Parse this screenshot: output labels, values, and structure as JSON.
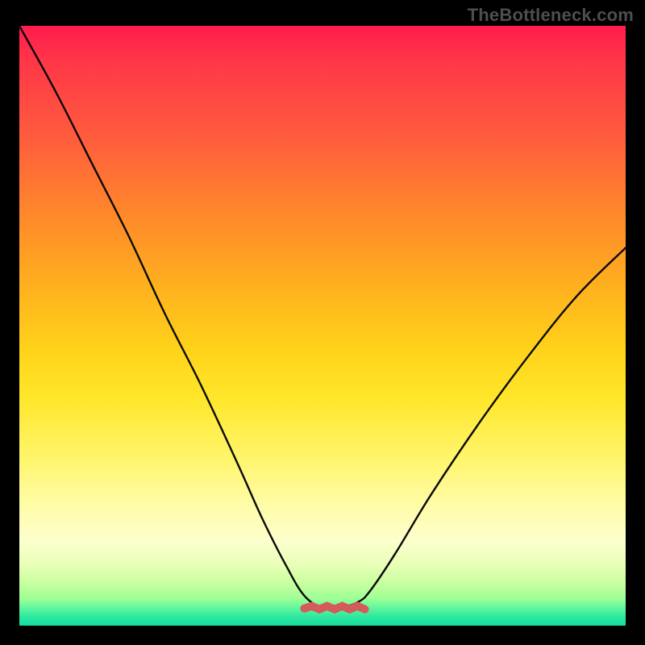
{
  "watermark": "TheBottleneck.com",
  "chart_data": {
    "type": "line",
    "title": "",
    "xlabel": "",
    "ylabel": "",
    "xlim": [
      0,
      100
    ],
    "ylim": [
      0,
      100
    ],
    "grid": false,
    "series": [
      {
        "name": "bottleneck-curve",
        "x": [
          0,
          6,
          12,
          18,
          24,
          30,
          36,
          40,
          44,
          47,
          50,
          53,
          56,
          58,
          62,
          68,
          76,
          84,
          92,
          100
        ],
        "values": [
          100,
          89,
          77,
          65,
          52,
          40,
          27,
          18,
          10,
          5,
          3,
          3,
          4,
          6,
          12,
          22,
          34,
          45,
          55,
          63
        ]
      }
    ],
    "marker": {
      "name": "minimum-marker",
      "x_range": [
        47,
        57
      ],
      "y": 3,
      "color": "#d55a5a"
    },
    "background_gradient": {
      "stops": [
        {
          "pos": 0,
          "color": "#ff1b4d"
        },
        {
          "pos": 0.32,
          "color": "#ff8a2a"
        },
        {
          "pos": 0.62,
          "color": "#ffe62a"
        },
        {
          "pos": 0.86,
          "color": "#fdffcd"
        },
        {
          "pos": 1.0,
          "color": "#16dca0"
        }
      ]
    }
  }
}
